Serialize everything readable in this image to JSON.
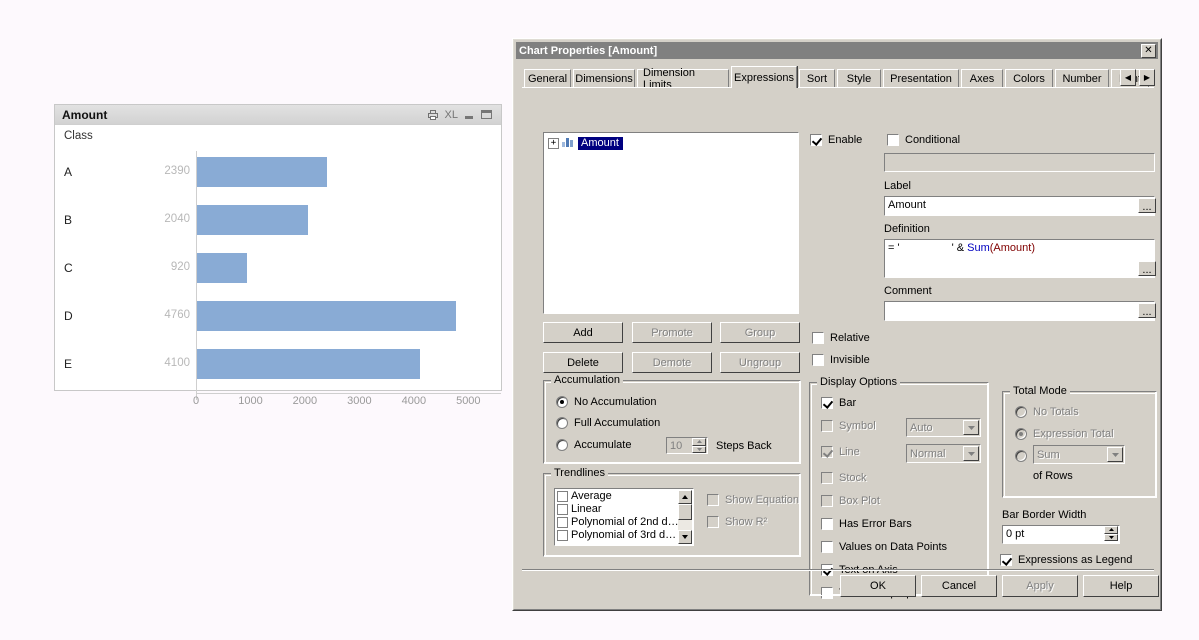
{
  "chart_object": {
    "title": "Amount",
    "caption_icons": [
      "print-icon",
      "excel-export-icon",
      "minimize-icon",
      "maximize-icon"
    ],
    "excel_label": "XL",
    "dimension_label": "Class"
  },
  "chart_data": {
    "type": "bar",
    "orientation": "horizontal",
    "title": "Amount",
    "xlabel": "",
    "ylabel": "Class",
    "categories": [
      "A",
      "B",
      "C",
      "D",
      "E"
    ],
    "values": [
      2390,
      2040,
      920,
      4760,
      4100
    ],
    "value_labels": [
      "2390",
      "2040",
      "920",
      "4760",
      "4100"
    ],
    "xticks": [
      0,
      1000,
      2000,
      3000,
      4000,
      5000
    ],
    "xtick_labels": [
      "0",
      "1000",
      "2000",
      "3000",
      "4000",
      "5000"
    ],
    "xlim": [
      0,
      5600
    ],
    "grid": false,
    "legend": "none",
    "bar_color": "#89ABD5",
    "plot_background": "#ffffff",
    "axis_color": "#cfcfcf",
    "value_label_color": "#b8b8b8"
  },
  "dialog": {
    "title": "Chart Properties [Amount]",
    "close_label": "✕",
    "tabs": [
      {
        "label": "General",
        "selected": false
      },
      {
        "label": "Dimensions",
        "selected": false
      },
      {
        "label": "Dimension Limits",
        "selected": false
      },
      {
        "label": "Expressions",
        "selected": true
      },
      {
        "label": "Sort",
        "selected": false
      },
      {
        "label": "Style",
        "selected": false
      },
      {
        "label": "Presentation",
        "selected": false
      },
      {
        "label": "Axes",
        "selected": false
      },
      {
        "label": "Colors",
        "selected": false
      },
      {
        "label": "Number",
        "selected": false
      },
      {
        "label": "Font",
        "selected": false
      }
    ],
    "tab_scroll_left": "◀",
    "tab_scroll_right": "▶",
    "expression_tree": {
      "expand_glyph": "+",
      "node_label": "Amount",
      "node_icon": "bar-chart-icon"
    },
    "list_buttons": [
      {
        "label": "Add",
        "enabled": true
      },
      {
        "label": "Promote",
        "enabled": false
      },
      {
        "label": "Group",
        "enabled": false
      },
      {
        "label": "Delete",
        "enabled": true
      },
      {
        "label": "Demote",
        "enabled": false
      },
      {
        "label": "Ungroup",
        "enabled": false
      }
    ],
    "enable": {
      "label": "Enable",
      "checked": true
    },
    "conditional": {
      "label": "Conditional",
      "checked": false,
      "value": "",
      "enabled": false
    },
    "label_field": {
      "label": "Label",
      "value": "Amount",
      "ellipsis": "..."
    },
    "definition_field": {
      "label": "Definition",
      "prefix": "= '",
      "spacer": "                 ",
      "quote": "'",
      "amp": " & ",
      "func": "Sum",
      "open_paren": "(",
      "arg": "Amount",
      "close_paren": ")",
      "ellipsis": "..."
    },
    "comment_field": {
      "label": "Comment",
      "value": "",
      "ellipsis": "..."
    },
    "relative": {
      "label": "Relative",
      "checked": false
    },
    "invisible": {
      "label": "Invisible",
      "checked": false
    },
    "accumulation": {
      "title": "Accumulation",
      "options": [
        {
          "label": "No Accumulation",
          "selected": true,
          "enabled": true
        },
        {
          "label": "Full Accumulation",
          "selected": false,
          "enabled": true
        },
        {
          "label": "Accumulate",
          "selected": false,
          "enabled": true
        }
      ],
      "steps_value": "10",
      "steps_label": "Steps Back",
      "steps_enabled": false
    },
    "trendlines": {
      "title": "Trendlines",
      "items": [
        {
          "label": "Average",
          "checked": false
        },
        {
          "label": "Linear",
          "checked": false
        },
        {
          "label": "Polynomial of 2nd d…",
          "checked": false
        },
        {
          "label": "Polynomial of 3rd d…",
          "checked": false
        }
      ],
      "show_equation": {
        "label": "Show Equation",
        "checked": false,
        "enabled": false
      },
      "show_r2": {
        "label": "Show R²",
        "checked": false,
        "enabled": false
      },
      "scroll_up": "▲",
      "scroll_down": "▼"
    },
    "display_options": {
      "title": "Display Options",
      "items": [
        {
          "label": "Bar",
          "checked": true,
          "enabled": true
        },
        {
          "label": "Symbol",
          "checked": false,
          "enabled": false
        },
        {
          "label": "Line",
          "checked": true,
          "enabled": false
        },
        {
          "label": "Stock",
          "checked": false,
          "enabled": false
        },
        {
          "label": "Box Plot",
          "checked": false,
          "enabled": false
        },
        {
          "label": "Has Error Bars",
          "checked": false,
          "enabled": true
        },
        {
          "label": "Values on Data Points",
          "checked": false,
          "enabled": true
        },
        {
          "label": "Text on Axis",
          "checked": true,
          "enabled": true
        },
        {
          "label": "Text as Pop-up",
          "checked": false,
          "enabled": true
        }
      ],
      "symbol_combo": {
        "value": "Auto",
        "enabled": false
      },
      "line_combo": {
        "value": "Normal",
        "enabled": false
      },
      "combo_arrow": "▼"
    },
    "total_mode": {
      "title": "Total Mode",
      "options": [
        {
          "label": "No Totals",
          "selected": false,
          "enabled": false
        },
        {
          "label": "Expression Total",
          "selected": true,
          "enabled": false
        },
        {
          "label": "",
          "selected": false,
          "enabled": false
        }
      ],
      "aggregation": {
        "value": "Sum",
        "enabled": false
      },
      "of_rows_label": "of Rows",
      "combo_arrow": "▼"
    },
    "bar_border_width": {
      "label": "Bar Border Width",
      "value": "0 pt",
      "up": "▲",
      "down": "▼"
    },
    "expressions_as_legend": {
      "label": "Expressions as Legend",
      "checked": true
    },
    "footer_buttons": [
      {
        "label": "OK",
        "enabled": true
      },
      {
        "label": "Cancel",
        "enabled": true
      },
      {
        "label": "Apply",
        "enabled": false
      },
      {
        "label": "Help",
        "enabled": true
      }
    ]
  }
}
